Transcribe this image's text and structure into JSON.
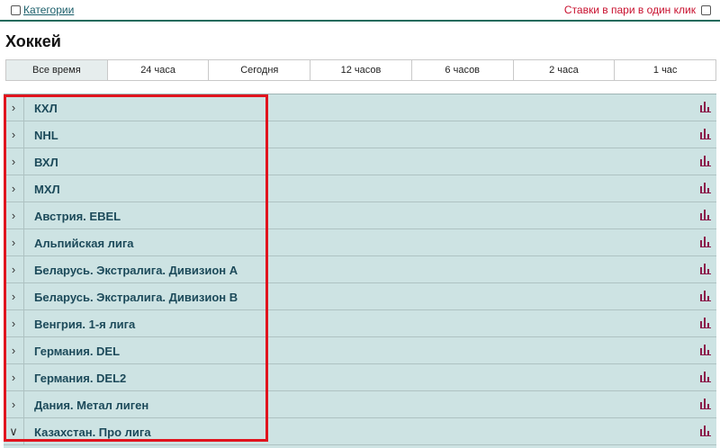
{
  "header": {
    "categories_link": "Категории",
    "one_click_label": "Ставки в пари в один клик"
  },
  "page_title": "Хоккей",
  "time_tabs": [
    {
      "label": "Все время",
      "active": true
    },
    {
      "label": "24 часа"
    },
    {
      "label": "Сегодня"
    },
    {
      "label": "12 часов"
    },
    {
      "label": "6 часов"
    },
    {
      "label": "2 часа"
    },
    {
      "label": "1 час"
    }
  ],
  "leagues": [
    {
      "name": "КХЛ",
      "expanded": false
    },
    {
      "name": "NHL",
      "expanded": false
    },
    {
      "name": "ВХЛ",
      "expanded": false
    },
    {
      "name": "МХЛ",
      "expanded": false
    },
    {
      "name": "Австрия. EBEL",
      "expanded": false
    },
    {
      "name": "Альпийская лига",
      "expanded": false
    },
    {
      "name": "Беларусь. Экстралига. Дивизион А",
      "expanded": false
    },
    {
      "name": "Беларусь. Экстралига. Дивизион В",
      "expanded": false
    },
    {
      "name": "Венгрия. 1-я лига",
      "expanded": false
    },
    {
      "name": "Германия. DEL",
      "expanded": false
    },
    {
      "name": "Германия. DEL2",
      "expanded": false
    },
    {
      "name": "Дания. Метал лиген",
      "expanded": false
    },
    {
      "name": "Казахстан. Про лига",
      "expanded": true
    }
  ],
  "colors": {
    "accent_green": "#1f6a5c",
    "one_click_red": "#c8102e",
    "league_text": "#1c4a5a",
    "list_background": "#cde3e3",
    "stats_icon": "#8b1a4a",
    "highlight_border": "#e0141e"
  }
}
